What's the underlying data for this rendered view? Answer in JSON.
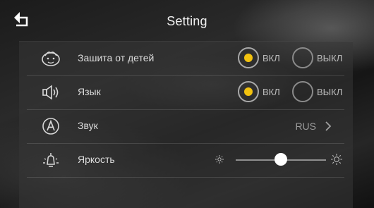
{
  "header": {
    "title": "Setting",
    "back_icon": "back-arrow-icon"
  },
  "settings": [
    {
      "label": "Зашита от детей",
      "icon": "child-face-icon",
      "options": [
        {
          "label": "ВКЛ",
          "selected": true
        },
        {
          "label": "ВЫКЛ",
          "selected": false
        }
      ]
    },
    {
      "label": "Язык",
      "icon": "speaker-icon",
      "options": [
        {
          "label": "ВКЛ",
          "selected": true
        },
        {
          "label": "ВЫКЛ",
          "selected": false
        }
      ]
    },
    {
      "label": "Звук",
      "icon": "circled-a-icon",
      "value": "RUS"
    },
    {
      "label": "Яркость",
      "icon": "bulb-icon",
      "slider_value": 0.5
    }
  ],
  "colors": {
    "accent": "#f2c20f"
  }
}
